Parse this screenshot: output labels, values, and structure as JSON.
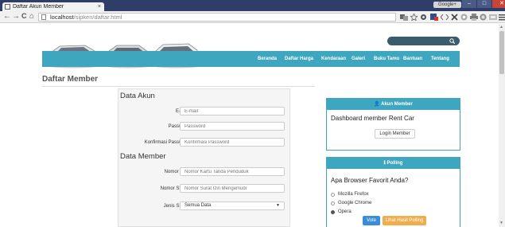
{
  "browser": {
    "tab_title": "Daftar Akun Member",
    "tab_close": "×",
    "user_badge": "Google+",
    "min": "–",
    "max": "□",
    "close": "✕",
    "url_host": "localhost",
    "url_path": "/sipken/daftar.html",
    "back": "←",
    "forward": "→",
    "reload": "C",
    "home": "⌂"
  },
  "header": {
    "search_icon": "🔍"
  },
  "nav": {
    "items": [
      "Beranda",
      "Daftar Harga",
      "Kendaraan",
      "Galeri",
      "Buku Tamu",
      "Bantuan",
      "Tentang"
    ]
  },
  "main": {
    "title": "Daftar Member",
    "akun_heading": "Data Akun",
    "member_heading": "Data Member",
    "fields": {
      "email_label": "E-mail",
      "email_placeholder": "E-mail",
      "password_label": "Password",
      "password_placeholder": "Password",
      "konfirmasi_label": "Konfirmasi Password",
      "konfirmasi_placeholder": "Konfirmasi Password",
      "ktp_label": "Nomor KTP",
      "ktp_placeholder": "Nomor Kartu Tanda Penduduk",
      "sim_label": "Nomor SIM *)",
      "sim_placeholder": "Nomor Surat Izin Mengemudi",
      "jenis_label": "Jenis SIM *)",
      "jenis_value": "Semua Data"
    }
  },
  "akun_panel": {
    "head": "Akun Member",
    "head_icon": "👤",
    "title": "Dashboard member Rent Car",
    "login_button": "Login Member"
  },
  "polling_panel": {
    "head": "Polling",
    "head_icon": "ℹ",
    "question": "Apa Browser Favorit Anda?",
    "options": [
      "Mozilla Firefox",
      "Google Chrome",
      "Opera"
    ],
    "selected": "Opera",
    "vote_button": "Vote",
    "result_button": "Lihat Hasil Polling"
  }
}
